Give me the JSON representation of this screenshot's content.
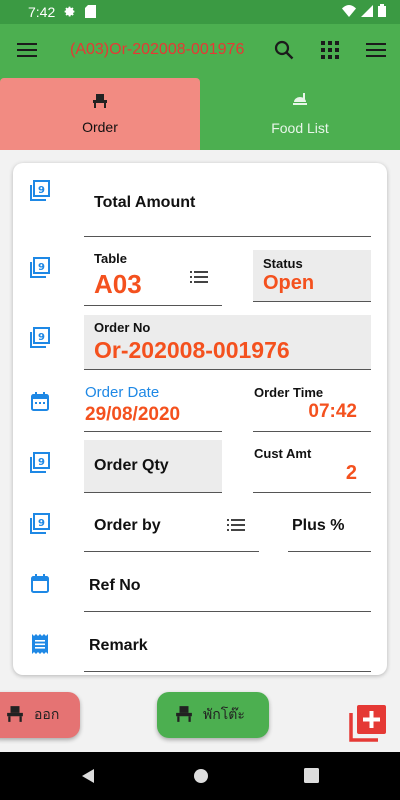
{
  "status_bar": {
    "time": "7:42"
  },
  "appbar": {
    "title": "(A03)Or-202008-001976"
  },
  "tabs": [
    {
      "label": "Order"
    },
    {
      "label": "Food List"
    }
  ],
  "form": {
    "total_amount_label": "Total Amount",
    "table_label": "Table",
    "table_value": "A03",
    "status_label": "Status",
    "status_value": "Open",
    "order_no_label": "Order No",
    "order_no_value": "Or-202008-001976",
    "order_date_label": "Order Date",
    "order_date_value": "29/08/2020",
    "order_time_label": "Order Time",
    "order_time_value": "07:42",
    "order_qty_label": "Order Qty",
    "cust_amt_label": "Cust Amt",
    "cust_amt_value": "2",
    "order_by_label": "Order by",
    "plus_label": "Plus %",
    "ref_no_label": "Ref No",
    "remark_label": "Remark"
  },
  "actions": {
    "exit_label": "ออก",
    "sit_label": "พักโต๊ะ"
  },
  "icons": {
    "list_icon": "filter-list-icon",
    "calendar_icon": "calendar-icon",
    "receipt_icon": "receipt-icon",
    "chair_icon": "chair-icon",
    "add_icon": "add-box-icon"
  },
  "colors": {
    "primary_green": "#4caf50",
    "tab_selected": "#f28b82",
    "value_orange": "#f4511e",
    "icon_blue": "#1e88e5",
    "add_red": "#e53935"
  }
}
